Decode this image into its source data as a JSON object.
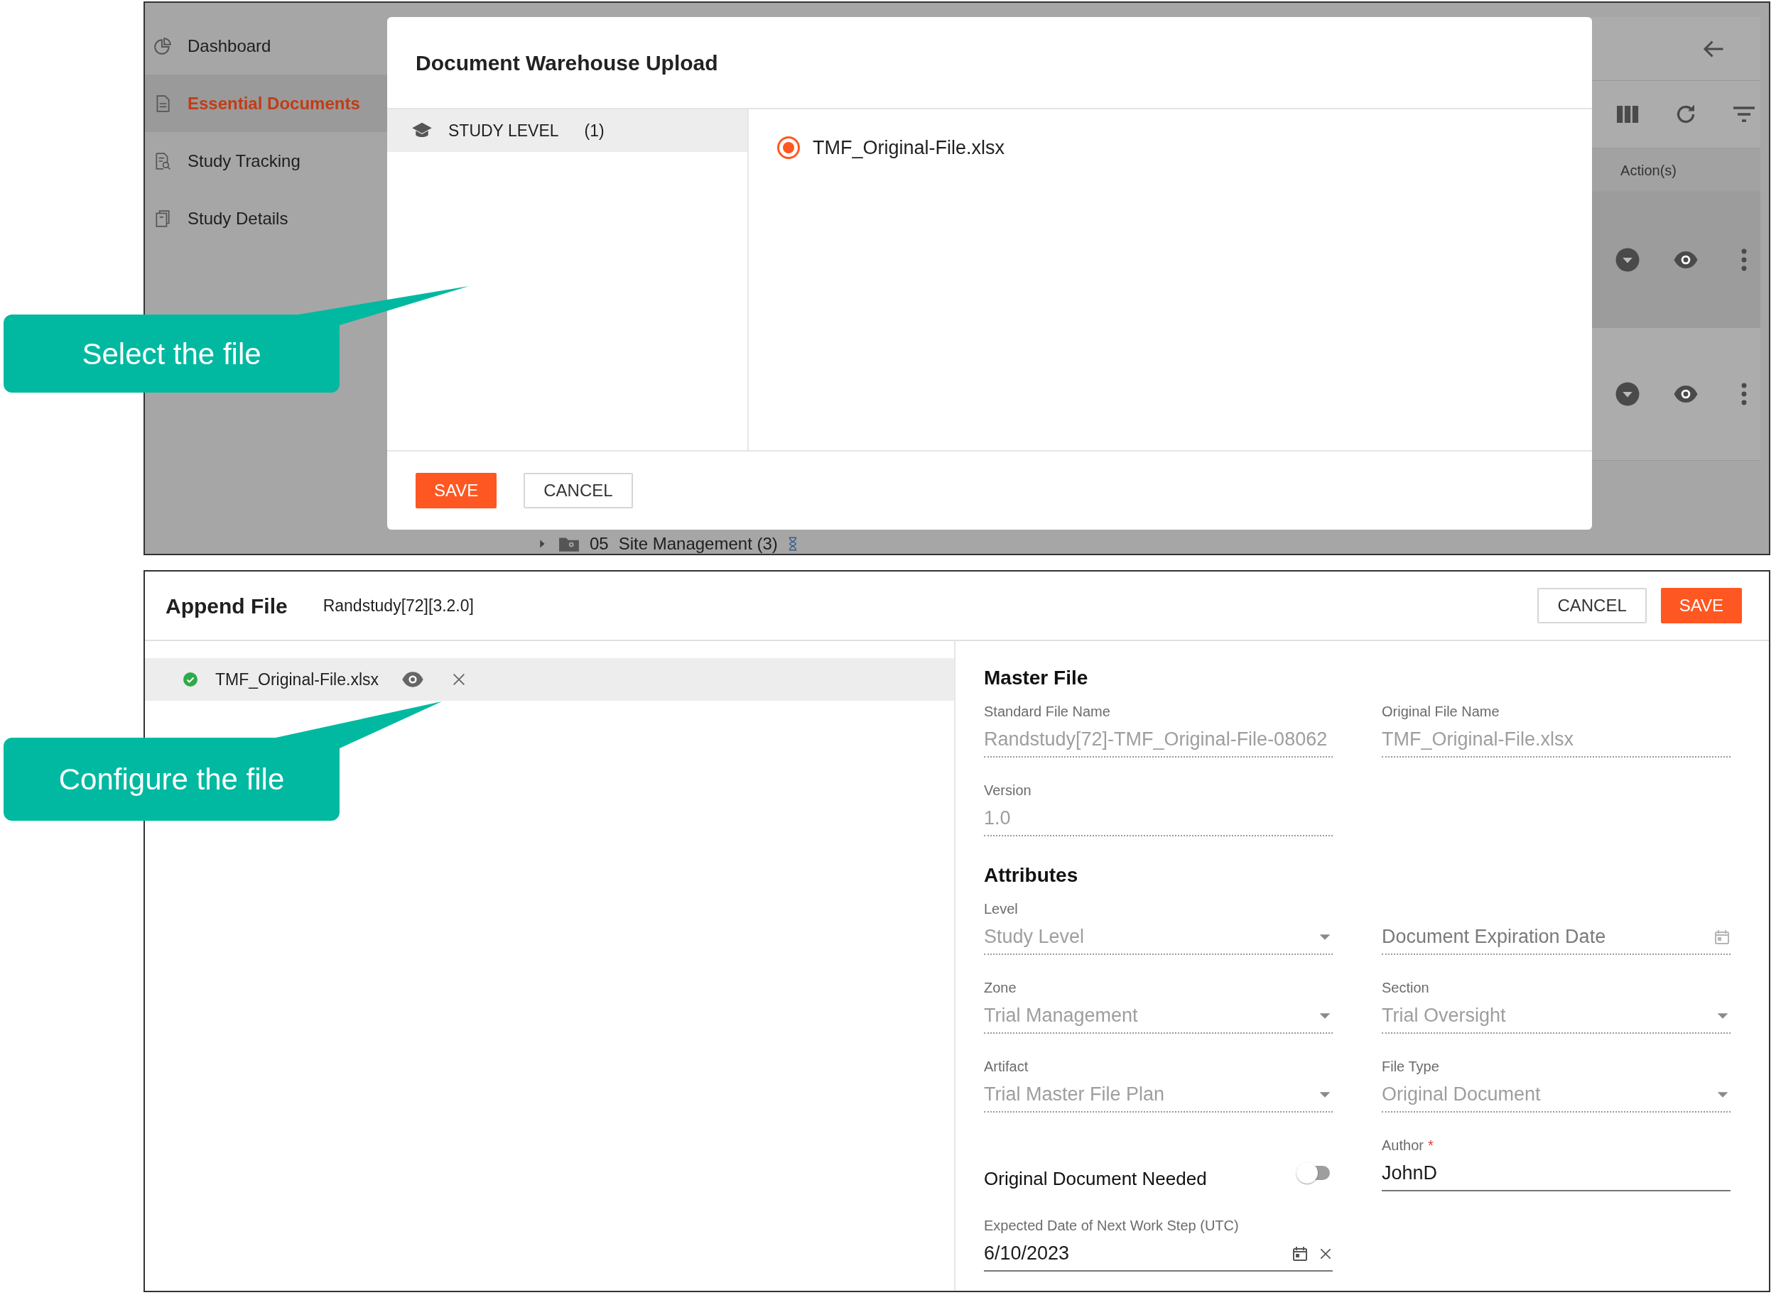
{
  "top_screen": {
    "sidebar": {
      "items": [
        {
          "label": "Dashboard",
          "selected": false
        },
        {
          "label": "Essential Documents",
          "selected": true
        },
        {
          "label": "Study Tracking",
          "selected": false
        },
        {
          "label": "Study Details",
          "selected": false
        }
      ]
    },
    "table": {
      "columns": [
        "Action(s)"
      ],
      "rows": [
        {
          "highlighted": true
        },
        {
          "highlighted": false
        }
      ]
    },
    "tree_row": {
      "number": "05",
      "label": "Site Management (3)",
      "expanded": false
    },
    "dialog": {
      "title": "Document Warehouse Upload",
      "levels": [
        {
          "label": "STUDY LEVEL",
          "count": "(1)",
          "selected": true
        }
      ],
      "files": [
        {
          "name": "TMF_Original-File.xlsx",
          "selected": true
        }
      ],
      "buttons": [
        {
          "label": "SAVE",
          "kind": "primary"
        },
        {
          "label": "CANCEL",
          "kind": "secondary"
        }
      ]
    },
    "callout": {
      "text": "Select the file"
    }
  },
  "append_screen": {
    "title": "Append File",
    "study": "Randstudy[72][3.2.0]",
    "buttons": [
      {
        "label": "CANCEL",
        "kind": "secondary"
      },
      {
        "label": "SAVE",
        "kind": "primary"
      }
    ],
    "files": [
      {
        "name": "TMF_Original-File.xlsx",
        "uploaded": true
      }
    ],
    "sections": [
      {
        "title": "Master File",
        "fields": [
          {
            "label": "Standard File Name",
            "kind": "text",
            "value": "Randstudy[72]-TMF_Original-File-08062",
            "disabled": true
          },
          {
            "label": "Version",
            "kind": "text",
            "value": "1.0",
            "disabled": true
          },
          {
            "label": "Original File Name",
            "kind": "text",
            "value": "TMF_Original-File.xlsx",
            "disabled": true
          }
        ]
      },
      {
        "title": "Attributes",
        "fields": [
          {
            "label": "Level",
            "kind": "select",
            "value": "Study Level",
            "disabled": true
          },
          {
            "label": "Zone",
            "kind": "select",
            "value": "Trial Management",
            "disabled": true
          },
          {
            "label": "Artifact",
            "kind": "select",
            "value": "Trial Master File Plan",
            "disabled": true
          },
          {
            "label": "Original Document Needed",
            "kind": "toggle",
            "on": false
          },
          {
            "label": "Expected Date of Next Work Step (UTC)",
            "kind": "date",
            "value": "6/10/2023",
            "disabled": false,
            "clearable": true
          },
          {
            "kind": "date",
            "placeholder": "Document Expiration Date",
            "disabled": true
          },
          {
            "label": "Section",
            "kind": "select",
            "value": "Trial Oversight",
            "disabled": true
          },
          {
            "label": "File Type",
            "kind": "select",
            "value": "Original Document",
            "disabled": true
          },
          {
            "label": "Author",
            "kind": "text",
            "value": "JohnD",
            "disabled": false,
            "required_mark": "*"
          }
        ]
      }
    ],
    "callout": {
      "text": "Configure the file"
    }
  }
}
